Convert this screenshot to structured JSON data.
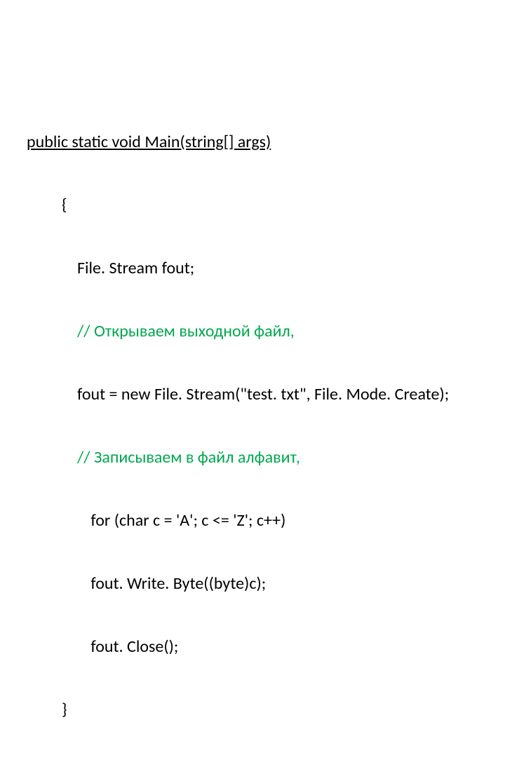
{
  "code": {
    "line1": "public static void Main(string[] args)",
    "line2": "{",
    "line3": "File. Stream fout;",
    "line4": "// Открываем выходной файл,",
    "line5": "fout = new File. Stream(\"test. txt\", File. Mode. Create);",
    "line6": "// Записываем в файл алфавит,",
    "line7": " for (char c = 'A'; c <= 'Z'; c++)",
    "line8": " fout. Write. Byte((byte)c);",
    "line9": " fout. Close();",
    "line10": "}"
  }
}
